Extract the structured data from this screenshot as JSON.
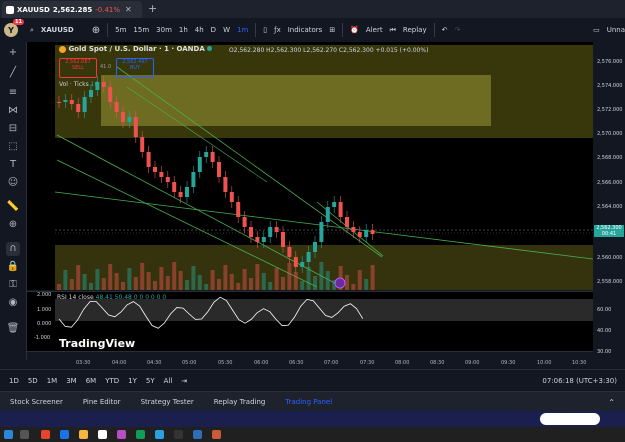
{
  "browser_tab": {
    "symbol": "XAUUSD",
    "price": "2,562.285",
    "change": "-0.41%"
  },
  "toolbar": {
    "avatar_letter": "Y",
    "avatar_badge": "11",
    "symbol": "XAUUSD",
    "intervals": [
      "5m",
      "15m",
      "30m",
      "1h",
      "4h",
      "D",
      "W",
      "1m"
    ],
    "indicators_label": "Indicators",
    "alert_label": "Alert",
    "replay_label": "Replay",
    "right_label": "Unna"
  },
  "chart": {
    "title": "Gold Spot / U.S. Dollar · 1 · OANDA",
    "ohlc": "O2,562.280 H2,562.300 L2,562.270 C2,562.300 +0.015 (+0.00%)",
    "sell_price": "2,562.087",
    "sell_label": "SELL",
    "spread": "41.0",
    "buy_price": "2,562.497",
    "buy_label": "BUY",
    "vol_label": "Vol · Ticks",
    "vol_value": "16",
    "current_price": "2,562.300",
    "current_time_tag": "00:41",
    "watermark": "TradingView"
  },
  "price_axis": [
    "2,576.000",
    "2,574.000",
    "2,572.000",
    "2,570.000",
    "2,568.000",
    "2,566.000",
    "2,564.000",
    "2,562.000",
    "2,560.000",
    "2,558.000"
  ],
  "rsi": {
    "label": "RSI 14 close",
    "values": "48.41 50.48 0 0 0 0 0 0",
    "left_axis": [
      "2.000",
      "1.000",
      "0.000",
      "-1.000"
    ],
    "right_axis": [
      "60.00",
      "40.00",
      "30.00"
    ]
  },
  "time_axis": [
    "03:30",
    "04:00",
    "04:30",
    "05:00",
    "05:30",
    "06:00",
    "06:30",
    "07:00",
    "07:30",
    "08:00",
    "08:30",
    "09:00",
    "09:30",
    "10:00",
    "10:30"
  ],
  "bottombar": {
    "ranges": [
      "1D",
      "5D",
      "1M",
      "3M",
      "6M",
      "YTD",
      "1Y",
      "5Y",
      "All"
    ],
    "clock": "07:06:18 (UTC+3:30)"
  },
  "panels": [
    "Stock Screener",
    "Pine Editor",
    "Strategy Tester",
    "Replay Trading",
    "Trading Panel"
  ],
  "colors": {
    "up": "#26a69a",
    "down": "#ef5350",
    "zone": "#6b6a1f",
    "accent": "#2962ff"
  }
}
